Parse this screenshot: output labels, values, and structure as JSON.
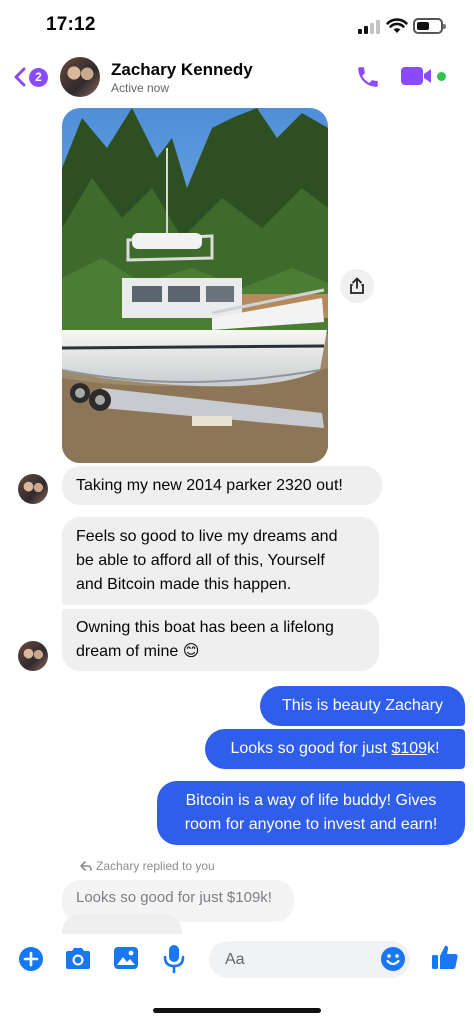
{
  "status_bar": {
    "time": "17:12",
    "battery_level": 0.55
  },
  "header": {
    "back_badge": "2",
    "contact_name": "Zachary Kennedy",
    "contact_status": "Active now"
  },
  "messages": {
    "m1": "Taking my new 2014 parker 2320 out!",
    "m2_line1": "Feels so good to live my dreams and",
    "m2_line2": "be able to afford all of this, Yourself",
    "m2_line3": "and Bitcoin made this happen.",
    "m3_line1": "Owning this boat has been a lifelong",
    "m3_line2": "dream of mine 😊",
    "m4": "This is beauty Zachary",
    "m5_prefix": "Looks so good for just ",
    "m5_link": "$109",
    "m5_suffix": "k!",
    "m6_line1": "Bitcoin is a way of life buddy! Gives",
    "m6_line2": "room for anyone to invest and earn!"
  },
  "reply": {
    "label": "Zachary replied to you",
    "quote": "Looks so good for just $109k!"
  },
  "composer": {
    "placeholder": "Aa"
  },
  "colors": {
    "accent": "#2f5eea",
    "header_icons": "#8a4bff",
    "composer_icons": "#1877f2",
    "online": "#31c24d",
    "incoming_bubble": "#efefef"
  },
  "icons": {
    "back": "chevron-left-icon",
    "call": "phone-icon",
    "video": "video-camera-icon",
    "share": "share-icon",
    "reply": "reply-arrow-icon",
    "plus": "plus-circle-icon",
    "camera": "camera-icon",
    "gallery": "image-icon",
    "mic": "microphone-icon",
    "emoji": "emoji-icon",
    "like": "thumbs-up-icon"
  }
}
